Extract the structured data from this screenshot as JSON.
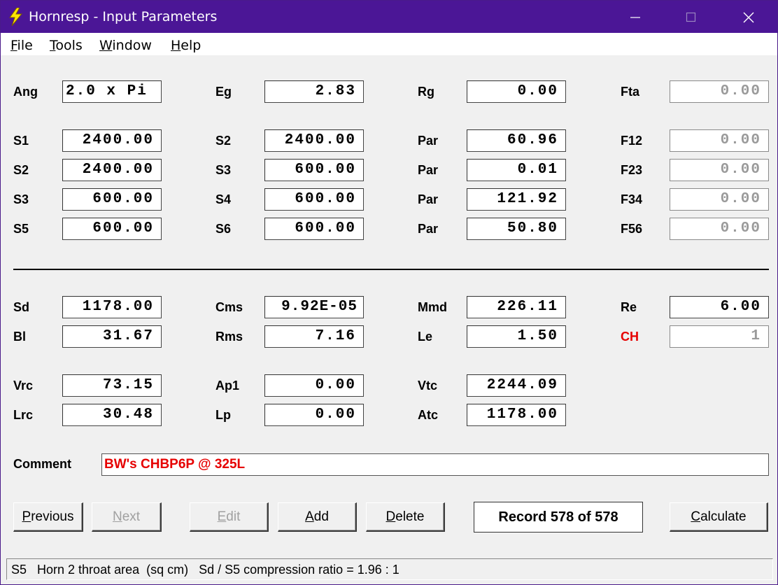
{
  "window": {
    "title": "Hornresp - Input Parameters",
    "titlebar_color": "#4b1696",
    "app_icon": "lightning-bolt-icon"
  },
  "menu": {
    "file": {
      "mnemonic": "F",
      "rest": "ile"
    },
    "tools": {
      "mnemonic": "T",
      "rest": "ools"
    },
    "window": {
      "mnemonic": "W",
      "rest": "indow"
    },
    "help": {
      "mnemonic": "H",
      "rest": "elp"
    }
  },
  "params": {
    "ang": {
      "label": "Ang",
      "value": "2.0 x Pi"
    },
    "eg": {
      "label": "Eg",
      "value": "2.83"
    },
    "rg": {
      "label": "Rg",
      "value": "0.00"
    },
    "fta": {
      "label": "Fta",
      "value": "0.00"
    },
    "r1": {
      "s_a": {
        "label": "S1",
        "value": "2400.00"
      },
      "s_b": {
        "label": "S2",
        "value": "2400.00"
      },
      "par": {
        "label": "Par",
        "value": "60.96"
      },
      "f": {
        "label": "F12",
        "value": "0.00"
      }
    },
    "r2": {
      "s_a": {
        "label": "S2",
        "value": "2400.00"
      },
      "s_b": {
        "label": "S3",
        "value": "600.00"
      },
      "par": {
        "label": "Par",
        "value": "0.01"
      },
      "f": {
        "label": "F23",
        "value": "0.00"
      }
    },
    "r3": {
      "s_a": {
        "label": "S3",
        "value": "600.00"
      },
      "s_b": {
        "label": "S4",
        "value": "600.00"
      },
      "par": {
        "label": "Par",
        "value": "121.92"
      },
      "f": {
        "label": "F34",
        "value": "0.00"
      }
    },
    "r4": {
      "s_a": {
        "label": "S5",
        "value": "600.00"
      },
      "s_b": {
        "label": "S6",
        "value": "600.00"
      },
      "par": {
        "label": "Par",
        "value": "50.80"
      },
      "f": {
        "label": "F56",
        "value": "0.00"
      }
    },
    "sd": {
      "label": "Sd",
      "value": "1178.00"
    },
    "cms": {
      "label": "Cms",
      "value": "9.92E-05"
    },
    "mmd": {
      "label": "Mmd",
      "value": "226.11"
    },
    "re": {
      "label": "Re",
      "value": "6.00"
    },
    "bl": {
      "label": "Bl",
      "value": "31.67"
    },
    "rms": {
      "label": "Rms",
      "value": "7.16"
    },
    "le": {
      "label": "Le",
      "value": "1.50"
    },
    "ch": {
      "label": "CH",
      "value": "1"
    },
    "vrc": {
      "label": "Vrc",
      "value": "73.15"
    },
    "ap1": {
      "label": "Ap1",
      "value": "0.00"
    },
    "vtc": {
      "label": "Vtc",
      "value": "2244.09"
    },
    "lrc": {
      "label": "Lrc",
      "value": "30.48"
    },
    "lp": {
      "label": "Lp",
      "value": "0.00"
    },
    "atc": {
      "label": "Atc",
      "value": "1178.00"
    }
  },
  "comment": {
    "label": "Comment",
    "value": "BW's CHBP6P @ 325L"
  },
  "buttons": {
    "previous": {
      "mnemonic": "P",
      "rest": "revious"
    },
    "next": {
      "mnemonic": "N",
      "rest": "ext"
    },
    "edit": {
      "mnemonic": "E",
      "rest": "dit"
    },
    "add": {
      "mnemonic": "A",
      "rest": "dd"
    },
    "delete": {
      "mnemonic": "D",
      "rest": "elete"
    },
    "calculate": {
      "mnemonic": "C",
      "rest": "alculate"
    }
  },
  "record": "Record 578 of 578",
  "status": "S5   Horn 2 throat area  (sq cm)   Sd / S5 compression ratio = 1.96 : 1",
  "colors": {
    "accent_red": "#e60000",
    "disabled": "#9a9a9a"
  }
}
